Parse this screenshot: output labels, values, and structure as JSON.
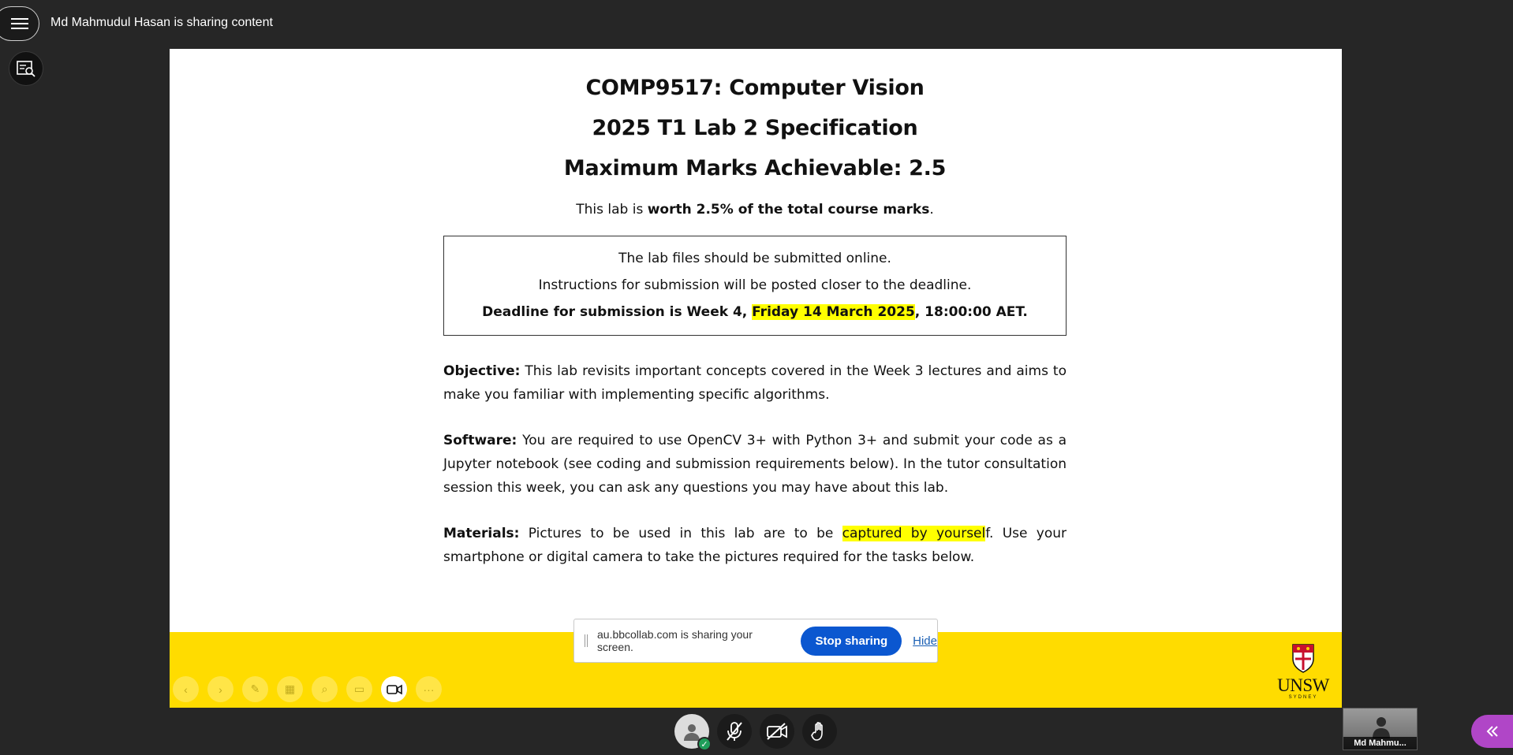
{
  "header": {
    "sharing_title": "Md Mahmudul Hasan is sharing content"
  },
  "icons": {
    "menu": "hamburger-menu-icon",
    "side_tool": "caption-search-icon",
    "participant": "avatar-icon",
    "mic": "mic-off-icon",
    "camera": "camera-off-icon",
    "hand": "raise-hand-icon",
    "collapse": "double-chevron-left-icon"
  },
  "slide": {
    "title1": "COMP9517: Computer Vision",
    "title2": "2025 T1 Lab 2 Specification",
    "title3": "Maximum Marks Achievable: 2.5",
    "worth_prefix": "This lab is ",
    "worth_bold": "worth 2.5% of the total course marks",
    "worth_suffix": ".",
    "box": {
      "line1": "The lab files should be submitted online.",
      "line2": "Instructions for submission will be posted closer to the deadline.",
      "line3_prefix": "Deadline for submission is Week 4, ",
      "line3_highlight": "Friday 14 March 2025",
      "line3_suffix": ", 18:00:00 AET."
    },
    "objective": {
      "label": "Objective:",
      "text": " This lab revisits important concepts covered in the Week 3 lectures and aims to make you familiar with implementing specific algorithms."
    },
    "software": {
      "label": "Software:",
      "text": " You are required to use OpenCV 3+ with Python 3+ and submit your code as a Jupyter notebook (see coding and submission requirements below). In the tutor consultation session this week, you can ask any questions you may have about this lab."
    },
    "materials": {
      "label": "Materials:",
      "text_before": " Pictures to be used in this lab are to be ",
      "highlight": "captured by yoursel",
      "text_after": "f. Use your smartphone or digital camera to take the pictures required for the tasks below."
    },
    "logo": {
      "word": "UNSW",
      "sub": "SYDNEY"
    }
  },
  "share_bar": {
    "message": "au.bbcollab.com is sharing your screen.",
    "stop_label": "Stop sharing",
    "hide_label": "Hide"
  },
  "video": {
    "name": "Md Mahmu..."
  },
  "colors": {
    "background": "#262626",
    "footer_yellow": "#ffdc00",
    "highlight": "#ffff00",
    "stop_button": "#0b57d0",
    "collapse_button": "#b046c7",
    "presence_green": "#1f9e5a"
  }
}
